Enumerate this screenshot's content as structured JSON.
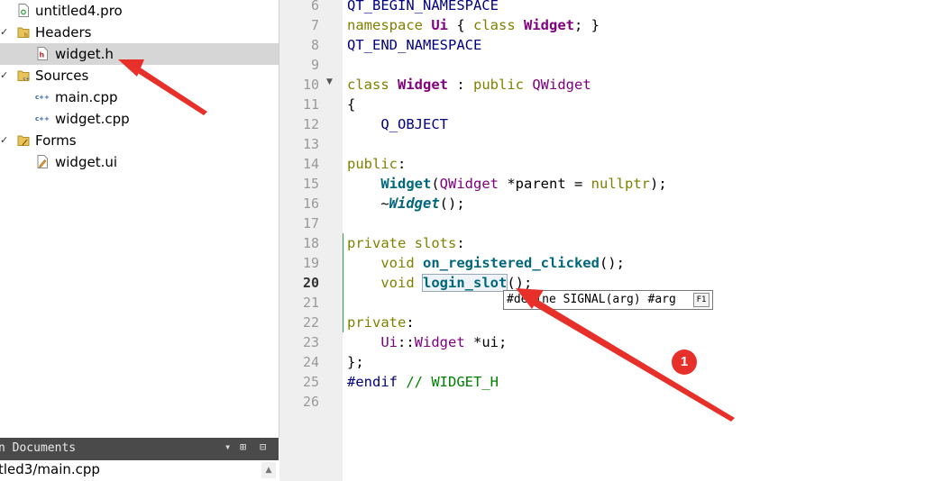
{
  "project_tree": {
    "items": [
      {
        "label": "untitled4.pro",
        "icon": "pro-file-icon",
        "arrow": ""
      },
      {
        "label": "Headers",
        "icon": "headers-folder-icon",
        "arrow": "✓"
      },
      {
        "label": "widget.h",
        "icon": "header-file-icon",
        "arrow": "",
        "selected": true
      },
      {
        "label": "Sources",
        "icon": "sources-folder-icon",
        "arrow": "✓"
      },
      {
        "label": "main.cpp",
        "icon": "cpp-file-icon",
        "arrow": ""
      },
      {
        "label": "widget.cpp",
        "icon": "cpp-file-icon",
        "arrow": ""
      },
      {
        "label": "Forms",
        "icon": "forms-folder-icon",
        "arrow": "✓"
      },
      {
        "label": "widget.ui",
        "icon": "ui-file-icon",
        "arrow": ""
      }
    ]
  },
  "open_documents": {
    "title": "n Documents",
    "items": [
      "tled3/main.cpp"
    ]
  },
  "editor": {
    "line_numbers": [
      "6",
      "7",
      "8",
      "9",
      "10",
      "11",
      "12",
      "13",
      "14",
      "15",
      "16",
      "17",
      "18",
      "19",
      "20",
      "21",
      "22",
      "23",
      "24",
      "25",
      "26"
    ],
    "current_line": "20",
    "tooltip": {
      "text": "#define SIGNAL(arg) #arg",
      "key": "F1"
    }
  },
  "annotation": {
    "badge": "1"
  },
  "colors": {
    "accent_red": "#e8302a",
    "change_bar": "#2ea043"
  }
}
